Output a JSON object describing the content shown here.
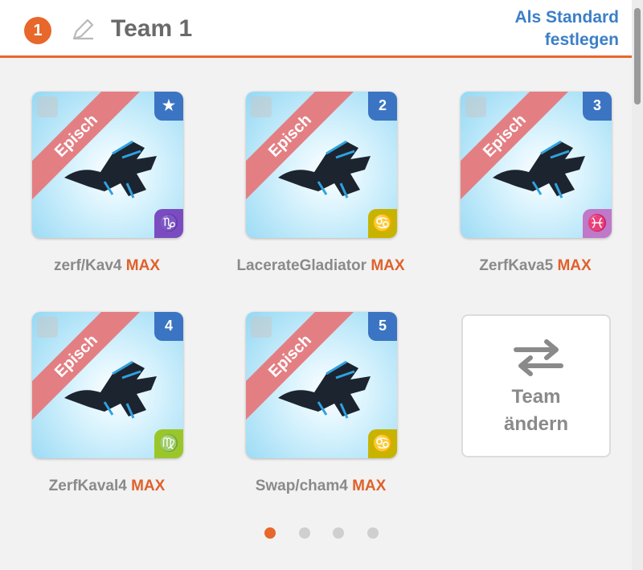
{
  "header": {
    "team_number": "1",
    "team_name": "Team 1",
    "default_line1": "Als Standard",
    "default_line2": "festlegen"
  },
  "cards": [
    {
      "rarity": "Episch",
      "badge": "★",
      "sign": "♑",
      "sign_color": "#7b4cc0",
      "name": "zerf/Kav4",
      "level": "MAX"
    },
    {
      "rarity": "Episch",
      "badge": "2",
      "sign": "♋",
      "sign_color": "#c8b400",
      "name": "LacerateGladiator",
      "level": "MAX"
    },
    {
      "rarity": "Episch",
      "badge": "3",
      "sign": "♓",
      "sign_color": "#c078c8",
      "name": "ZerfKava5",
      "level": "MAX"
    },
    {
      "rarity": "Episch",
      "badge": "4",
      "sign": "♍",
      "sign_color": "#9bc62a",
      "name": "ZerfKaval4",
      "level": "MAX"
    },
    {
      "rarity": "Episch",
      "badge": "5",
      "sign": "♋",
      "sign_color": "#c8b400",
      "name": "Swap/cham4",
      "level": "MAX"
    }
  ],
  "swap": {
    "line1": "Team",
    "line2": "ändern"
  },
  "pagination": {
    "count": 4,
    "active": 1
  },
  "colors": {
    "accent": "#e8672a",
    "link": "#3b7fc8",
    "epic_banner": "#e37f83",
    "badge_blue": "#3b74c2"
  }
}
